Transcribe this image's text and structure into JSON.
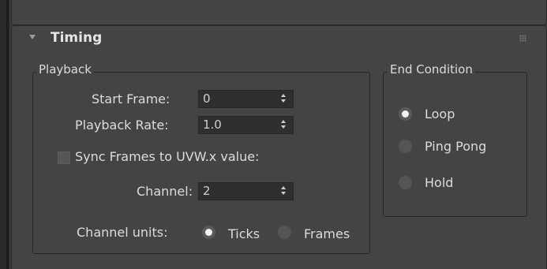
{
  "rollout": {
    "title": "Timing"
  },
  "playback": {
    "group_label": "Playback",
    "start_frame_label": "Start Frame:",
    "start_frame_value": "0",
    "playback_rate_label": "Playback Rate:",
    "playback_rate_value": "1.0",
    "sync_frames_label": "Sync Frames to UVW.x value:",
    "sync_frames_checked": false,
    "channel_label": "Channel:",
    "channel_value": "2",
    "channel_units_label": "Channel units:",
    "channel_units_options": [
      "Ticks",
      "Frames"
    ],
    "channel_units_selected": "Ticks"
  },
  "end_condition": {
    "group_label": "End Condition",
    "options": [
      "Loop",
      "Ping Pong",
      "Hold"
    ],
    "selected": "Loop"
  }
}
